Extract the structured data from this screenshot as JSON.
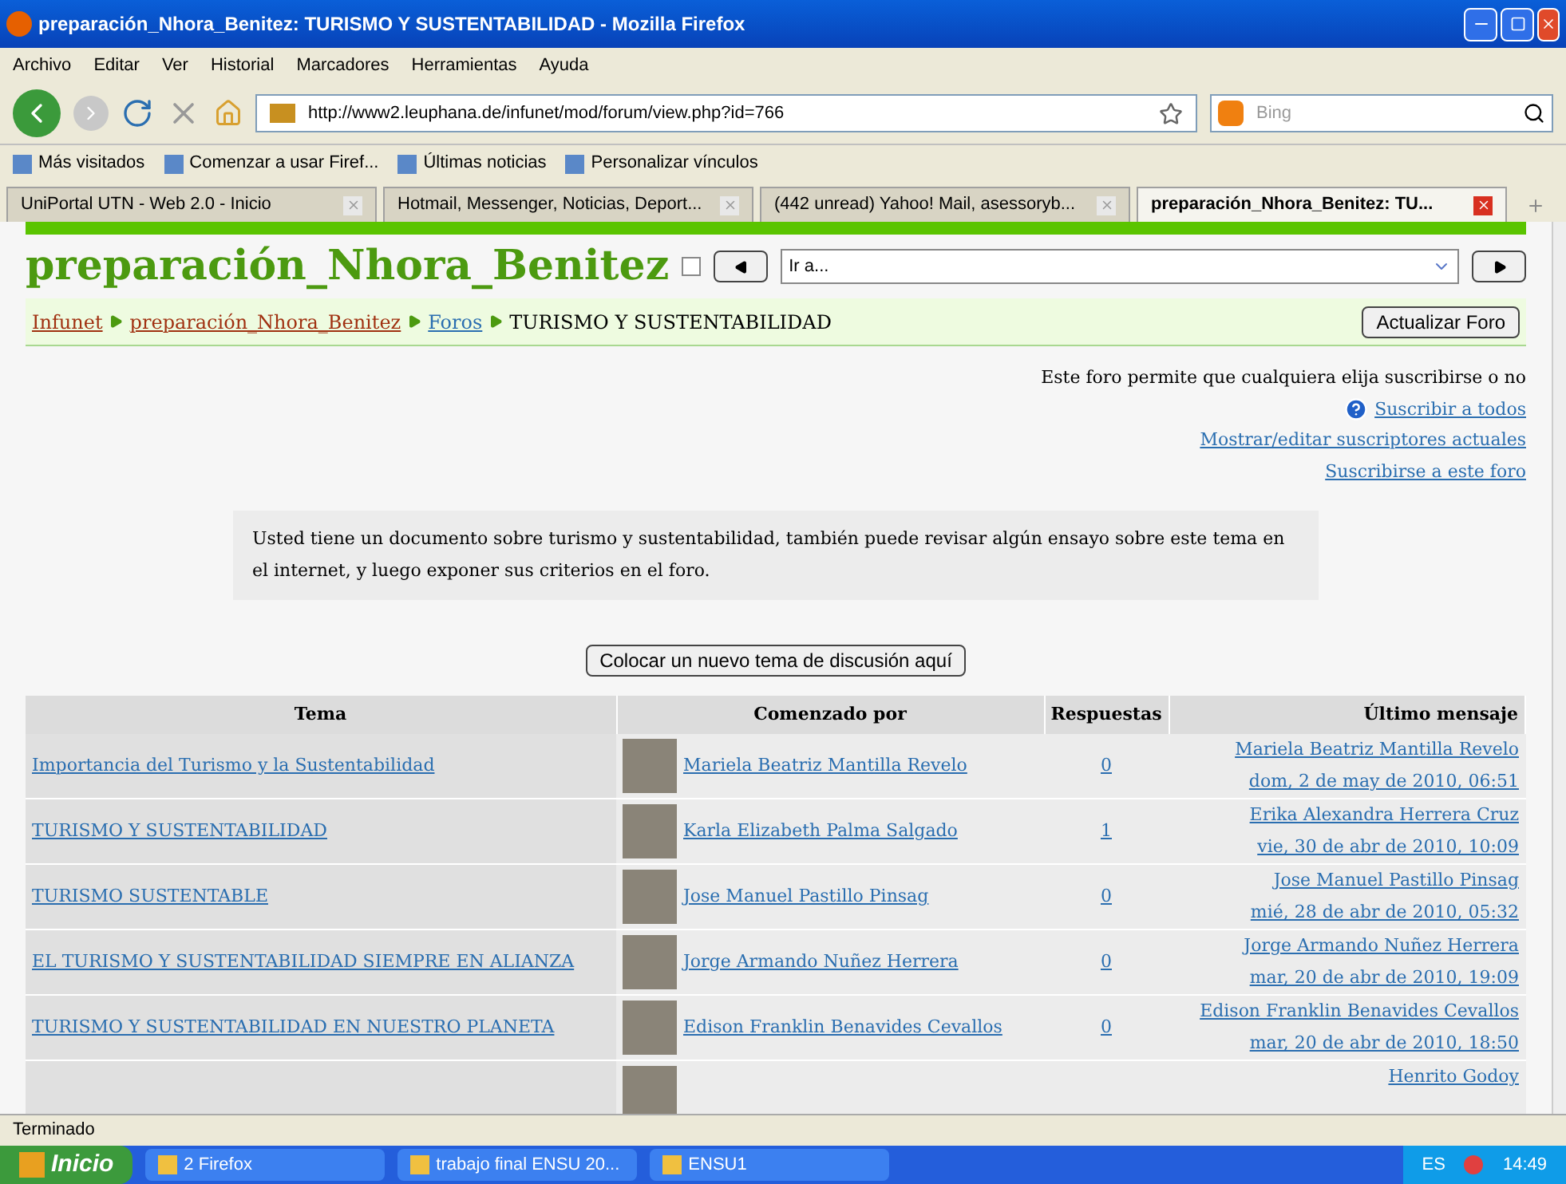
{
  "window": {
    "title": "preparación_Nhora_Benitez: TURISMO Y SUSTENTABILIDAD - Mozilla Firefox"
  },
  "menu": [
    "Archivo",
    "Editar",
    "Ver",
    "Historial",
    "Marcadores",
    "Herramientas",
    "Ayuda"
  ],
  "address": {
    "value": "http://www2.leuphana.de/infunet/mod/forum/view.php?id=766"
  },
  "search": {
    "placeholder": "Bing"
  },
  "bookmarks": [
    "Más visitados",
    "Comenzar a usar Firef...",
    "Últimas noticias",
    "Personalizar vínculos"
  ],
  "tabs": [
    {
      "label": "UniPortal UTN - Web 2.0 - Inicio",
      "selected": false
    },
    {
      "label": "Hotmail, Messenger, Noticias, Deport...",
      "selected": false
    },
    {
      "label": "(442 unread) Yahoo! Mail, asessoryb...",
      "selected": false
    },
    {
      "label": "preparación_Nhora_Benitez: TU...",
      "selected": true
    }
  ],
  "course": {
    "title": "preparación_Nhora_Benitez",
    "jump": {
      "value": "Ir a..."
    }
  },
  "breadcrumb": [
    "Infunet",
    "preparación_Nhora_Benitez",
    "Foros",
    "TURISMO Y SUSTENTABILIDAD"
  ],
  "update_button": "Actualizar Foro",
  "subscription": {
    "note": "Este foro permite que cualquiera elija suscribirse o no",
    "links": [
      "Suscribir a todos",
      "Mostrar/editar suscriptores actuales",
      "Suscribirse a este foro"
    ]
  },
  "intro": "Usted tiene un documento sobre turismo y sustentabilidad, también puede revisar algún ensayo sobre este tema en el internet, y luego exponer sus criterios en el foro.",
  "new_topic_button": "Colocar un nuevo tema de discusión aquí",
  "table": {
    "columns": [
      "Tema",
      "Comenzado por",
      "Respuestas",
      "Último mensaje"
    ],
    "rows": [
      {
        "topic": "Importancia del Turismo y la Sustentabilidad",
        "author": "Mariela Beatriz Mantilla Revelo",
        "replies": "0",
        "last_author": "Mariela Beatriz Mantilla Revelo",
        "last_date": "dom, 2 de may de 2010, 06:51"
      },
      {
        "topic": "TURISMO Y SUSTENTABILIDAD",
        "author": "Karla Elizabeth Palma Salgado",
        "replies": "1",
        "last_author": "Erika Alexandra Herrera Cruz",
        "last_date": "vie, 30 de abr de 2010, 10:09"
      },
      {
        "topic": "TURISMO SUSTENTABLE",
        "author": "Jose Manuel Pastillo Pinsag",
        "replies": "0",
        "last_author": "Jose Manuel Pastillo Pinsag",
        "last_date": "mié, 28 de abr de 2010, 05:32"
      },
      {
        "topic": "EL TURISMO Y SUSTENTABILIDAD SIEMPRE EN ALIANZA",
        "author": "Jorge Armando Nuñez Herrera",
        "replies": "0",
        "last_author": "Jorge Armando Nuñez Herrera",
        "last_date": "mar, 20 de abr de 2010, 19:09"
      },
      {
        "topic": "TURISMO Y SUSTENTABILIDAD EN NUESTRO PLANETA",
        "author": "Edison Franklin Benavides Cevallos",
        "replies": "0",
        "last_author": "Edison Franklin Benavides Cevallos",
        "last_date": "mar, 20 de abr de 2010, 18:50"
      },
      {
        "last_author": "Henrito Godoy"
      }
    ]
  },
  "status_bar": "Terminado",
  "taskbar": {
    "start": "Inicio",
    "tasks": [
      "2 Firefox",
      "trabajo final ENSU 20...",
      "ENSU1"
    ],
    "language": "ES",
    "clock": "14:49"
  }
}
